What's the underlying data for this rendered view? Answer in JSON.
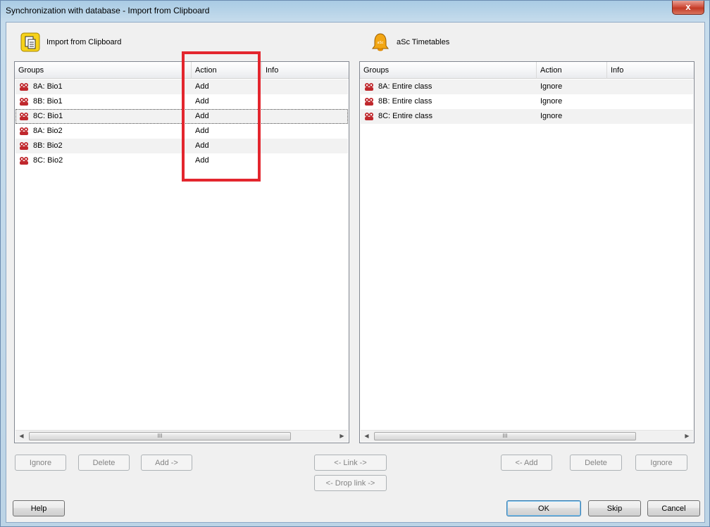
{
  "window": {
    "title": "Synchronization with database - Import from Clipboard",
    "close_label": "x"
  },
  "left_panel": {
    "title": "Import from Clipboard",
    "icon": "clipboard-icon",
    "columns": [
      "Groups",
      "Action",
      "Info"
    ],
    "rows": [
      {
        "group": "8A: Bio1",
        "action": "Add",
        "info": ""
      },
      {
        "group": "8B: Bio1",
        "action": "Add",
        "info": ""
      },
      {
        "group": "8C: Bio1",
        "action": "Add",
        "info": ""
      },
      {
        "group": "8A: Bio2",
        "action": "Add",
        "info": ""
      },
      {
        "group": "8B: Bio2",
        "action": "Add",
        "info": ""
      },
      {
        "group": "8C: Bio2",
        "action": "Add",
        "info": ""
      }
    ],
    "buttons": {
      "ignore": "Ignore",
      "delete": "Delete",
      "add": "Add ->"
    }
  },
  "right_panel": {
    "title": "aSc Timetables",
    "icon": "bell-icon",
    "columns": [
      "Groups",
      "Action",
      "Info"
    ],
    "rows": [
      {
        "group": "8A: Entire class",
        "action": "Ignore",
        "info": ""
      },
      {
        "group": "8B: Entire class",
        "action": "Ignore",
        "info": ""
      },
      {
        "group": "8C: Entire class",
        "action": "Ignore",
        "info": ""
      }
    ],
    "buttons": {
      "add": "<- Add",
      "delete": "Delete",
      "ignore": "Ignore"
    }
  },
  "center_buttons": {
    "link": "<- Link ->",
    "drop_link": "<- Drop link ->"
  },
  "footer": {
    "help": "Help",
    "ok": "OK",
    "skip": "Skip",
    "cancel": "Cancel"
  },
  "scrollbar_grip": "III",
  "colors": {
    "highlight": "#e3262e",
    "group_icon": "#c0282d"
  }
}
